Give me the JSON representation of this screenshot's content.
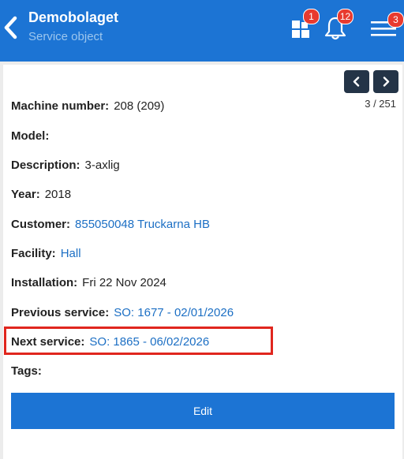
{
  "header": {
    "title": "Demobolaget",
    "subtitle": "Service object",
    "apps_badge": "1",
    "notifications_badge": "12",
    "menu_badge": "3"
  },
  "pager": {
    "counter": "3 / 251"
  },
  "fields": {
    "machine_number": {
      "label": "Machine number:",
      "value": "208 (209)"
    },
    "model": {
      "label": "Model:",
      "value": ""
    },
    "description": {
      "label": "Description:",
      "value": "3-axlig"
    },
    "year": {
      "label": "Year:",
      "value": "2018"
    },
    "customer": {
      "label": "Customer:",
      "value": "855050048 Truckarna HB"
    },
    "facility": {
      "label": "Facility:",
      "value": "Hall"
    },
    "installation": {
      "label": "Installation:",
      "value": "Fri 22 Nov 2024"
    },
    "previous_service": {
      "label": "Previous service:",
      "value": "SO: 1677 - 02/01/2026"
    },
    "next_service": {
      "label": "Next service:",
      "value": "SO: 1865 - 06/02/2026"
    },
    "tags": {
      "label": "Tags:",
      "value": ""
    }
  },
  "actions": {
    "edit_label": "Edit"
  },
  "colors": {
    "header_bg": "#1c74d4",
    "link": "#1c6fc4",
    "badge": "#e83a2f",
    "pager_bg": "#243447",
    "highlight": "#e0261e"
  }
}
